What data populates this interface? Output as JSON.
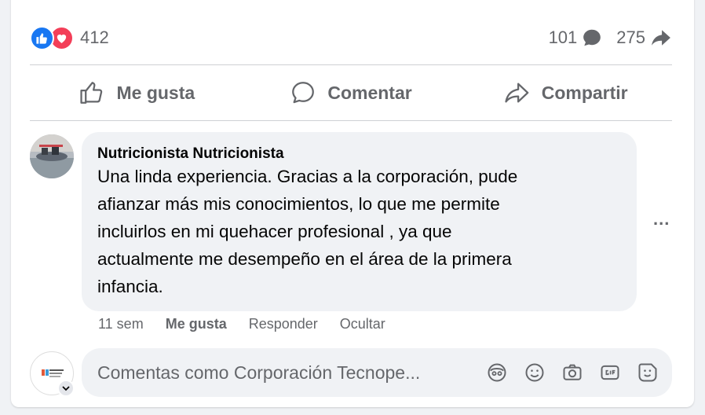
{
  "stats": {
    "reaction_count": "412",
    "comments_count": "101",
    "shares_count": "275",
    "reactions": [
      "like-icon",
      "love-icon"
    ]
  },
  "actions": {
    "like_label": "Me gusta",
    "comment_label": "Comentar",
    "share_label": "Compartir"
  },
  "comment": {
    "author": "Nutricionista Nutricionista",
    "lines": [
      "Una linda experiencia. Gracias a la corporación, pude",
      "afianzar más mis conocimientos, lo que me permite",
      "incluirlos en mi quehacer profesional , ya que",
      "actualmente me desempeño en el área de la primera",
      "infancia."
    ],
    "time": "11 sem",
    "like_label": "Me gusta",
    "reply_label": "Responder",
    "hide_label": "Ocultar",
    "more_label": "..."
  },
  "composer": {
    "placeholder": "Comentas como Corporación Tecnope...",
    "tools": [
      "avatar-sticker-icon",
      "emoji-icon",
      "camera-icon",
      "gif-icon",
      "sticker-icon"
    ]
  },
  "colors": {
    "like_blue": "#1877f2",
    "love_red": "#f33e58",
    "muted_text": "#65676b",
    "bubble_bg": "#f0f2f5"
  }
}
